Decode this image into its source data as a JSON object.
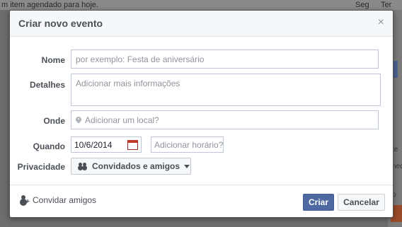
{
  "background": {
    "top_text": "m item agendado para hoje.",
    "day_seg": "Seg",
    "day_ter": "Ter",
    "side_text_1": "te",
    "side_text_2": "ned",
    "side_text_3": "o"
  },
  "dialog": {
    "title": "Criar novo evento",
    "close": "×"
  },
  "form": {
    "name_label": "Nome",
    "name_placeholder": "por exemplo: Festa de aniversário",
    "details_label": "Detalhes",
    "details_placeholder": "Adicionar mais informações",
    "where_label": "Onde",
    "where_placeholder": "Adicionar um local?",
    "when_label": "Quando",
    "date_value": "10/6/2014",
    "time_placeholder": "Adicionar horário?",
    "privacy_label": "Privacidade",
    "privacy_value": "Convidados e amigos"
  },
  "footer": {
    "invite_label": "Convidar amigos",
    "create_label": "Criar",
    "cancel_label": "Cancelar"
  },
  "colors": {
    "primary_button": "#4e69a2",
    "border": "#bdc7d8"
  }
}
